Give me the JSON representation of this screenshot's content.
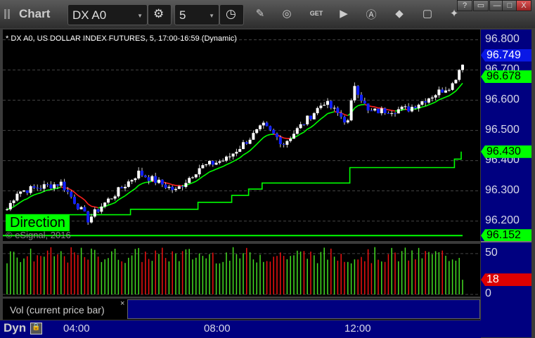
{
  "window": {
    "title": "Chart",
    "symbol": "DX A0",
    "interval": "5",
    "buttons": [
      "?",
      "▭",
      "—",
      "□",
      "X"
    ]
  },
  "toolbar_icons": [
    "settings-icon",
    "clock-icon",
    "pencil-icon",
    "study-icon",
    "get-icon",
    "play-icon",
    "alert-icon",
    "link-icon",
    "comment-icon",
    "twitter-icon"
  ],
  "chart": {
    "info": "* DX A0, US DOLLAR INDEX FUTURES, 5, 17:00-16:59 (Dynamic)",
    "y_ticks": [
      "96.800",
      "96.700",
      "96.600",
      "96.500",
      "96.400",
      "96.300",
      "96.200"
    ],
    "y_range": [
      96.134,
      96.834
    ],
    "tags": [
      {
        "label": "96.749",
        "value": 96.749,
        "bg": "#0a18e6",
        "fg": "#ffffff"
      },
      {
        "label": "96.678",
        "value": 96.678,
        "bg": "#00ff00",
        "fg": "#000000"
      },
      {
        "label": "96.430",
        "value": 96.43,
        "bg": "#00ff00",
        "fg": "#000000"
      },
      {
        "label": "96.152",
        "value": 96.152,
        "bg": "#00ff00",
        "fg": "#000000"
      }
    ],
    "direction_label": "Direction",
    "copyright": "© eSignal, 2016",
    "bars": 136,
    "price_waypoints": [
      [
        0,
        96.239
      ],
      [
        3,
        96.297
      ],
      [
        16,
        96.326
      ],
      [
        24,
        96.205
      ],
      [
        28,
        96.25
      ],
      [
        39,
        96.36
      ],
      [
        50,
        96.3
      ],
      [
        57,
        96.377
      ],
      [
        65,
        96.405
      ],
      [
        76,
        96.515
      ],
      [
        82,
        96.457
      ],
      [
        94,
        96.595
      ],
      [
        101,
        96.526
      ],
      [
        103,
        96.653
      ],
      [
        107,
        96.561
      ],
      [
        119,
        96.572
      ],
      [
        132,
        96.653
      ],
      [
        136,
        96.752
      ]
    ],
    "stop_steps": [
      [
        0,
        96.221
      ],
      [
        37,
        96.239
      ],
      [
        57,
        96.262
      ],
      [
        67,
        96.285
      ],
      [
        72,
        96.306
      ],
      [
        76,
        96.326
      ],
      [
        102,
        96.377
      ],
      [
        133,
        96.405
      ],
      [
        135,
        96.43
      ]
    ],
    "floor_line": 96.152
  },
  "volume": {
    "y_ticks": [
      "50",
      "0"
    ],
    "max": 62,
    "last_tag": "18",
    "legend": "Vol (current price bar)",
    "close": "×"
  },
  "time_axis": {
    "mode": "Dyn",
    "ticks": [
      "04:00",
      "08:00",
      "12:00"
    ]
  }
}
